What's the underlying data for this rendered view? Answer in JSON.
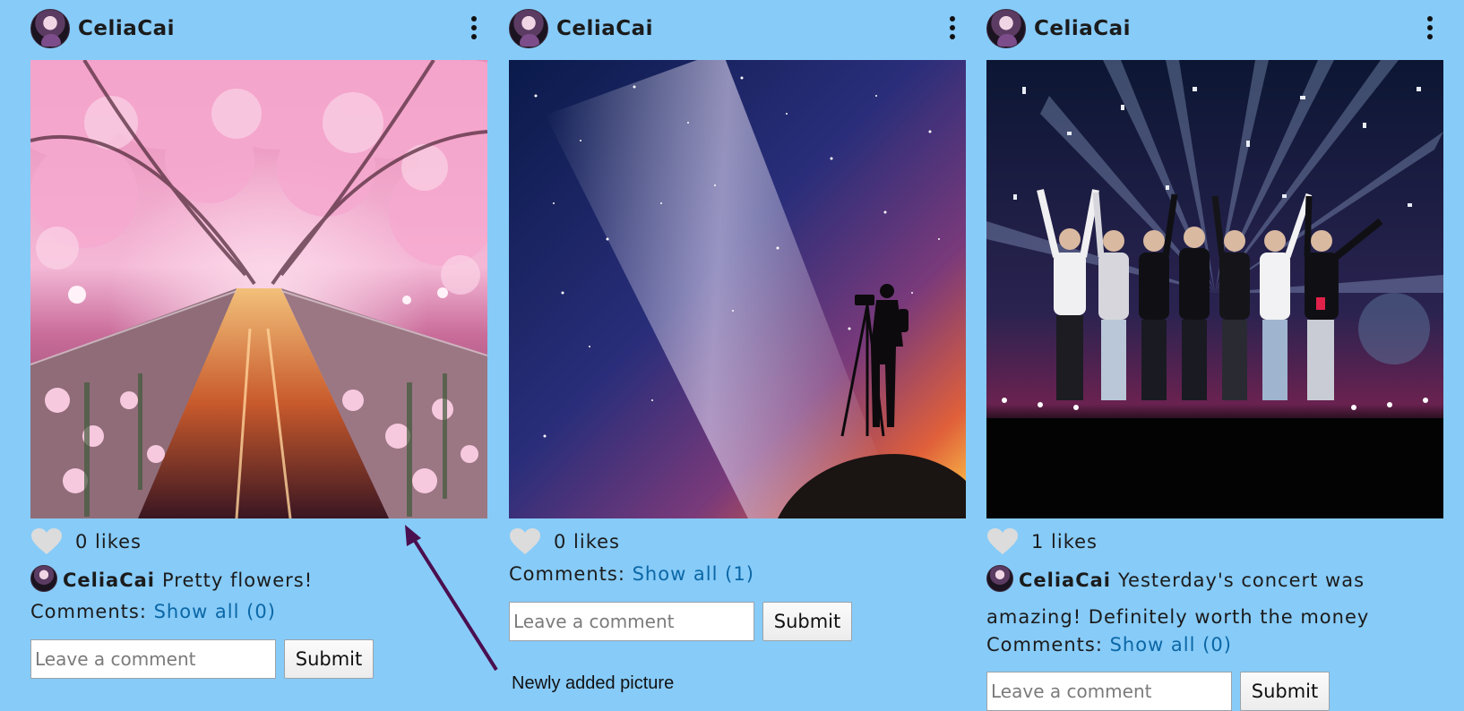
{
  "posts": [
    {
      "username": "CeliaCai",
      "likes_text": "0 likes",
      "caption_user": "CeliaCai",
      "caption_text": "Pretty flowers!",
      "comments_label": "Comments:",
      "show_all": "Show all (0)",
      "comment_placeholder": "Leave a comment",
      "submit_label": "Submit",
      "photo": "cherry-blossom-canal"
    },
    {
      "username": "CeliaCai",
      "likes_text": "0 likes",
      "comments_label": "Comments:",
      "show_all": "Show all (1)",
      "comment_placeholder": "Leave a comment",
      "submit_label": "Submit",
      "photo": "milky-way-photographer"
    },
    {
      "username": "CeliaCai",
      "likes_text": "1 likes",
      "caption_user": "CeliaCai",
      "caption_text": "Yesterday's concert was amazing! Definitely worth the money",
      "comments_label": "Comments:",
      "show_all": "Show all (0)",
      "comment_placeholder": "Leave a comment",
      "submit_label": "Submit",
      "photo": "concert-stage"
    }
  ],
  "annotation": {
    "text": "Newly added picture"
  },
  "colors": {
    "background": "#87cbf8",
    "link": "#0b67a6",
    "arrow": "#4a0f4f",
    "heart": "#dcdcdc"
  },
  "icons": [
    "more-vertical-icon",
    "heart-icon",
    "avatar"
  ]
}
